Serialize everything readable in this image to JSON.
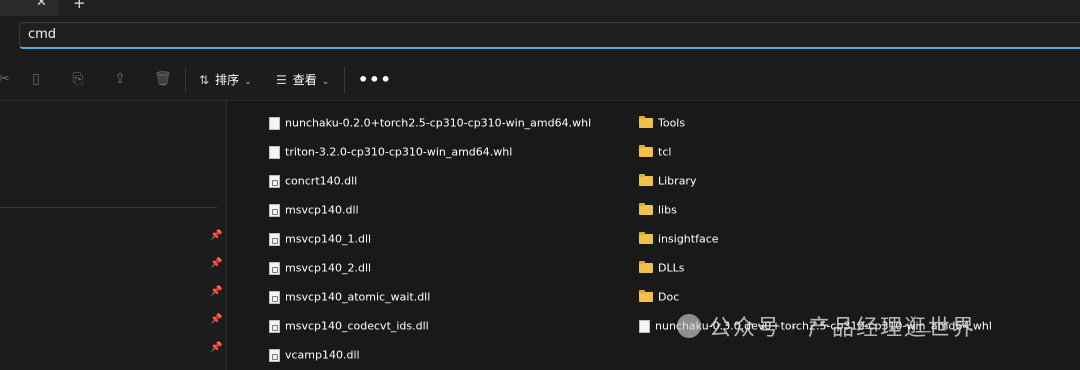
{
  "address_bar": {
    "value": "cmd"
  },
  "toolbar": {
    "sort_label": "排序",
    "view_label": "查看",
    "more_label": "•••"
  },
  "files_column1": [
    {
      "name": "nunchaku-0.2.0+torch2.5-cp310-cp310-win_amd64.whl",
      "type": "file"
    },
    {
      "name": "triton-3.2.0-cp310-cp310-win_amd64.whl",
      "type": "file"
    },
    {
      "name": "concrt140.dll",
      "type": "dll"
    },
    {
      "name": "msvcp140.dll",
      "type": "dll"
    },
    {
      "name": "msvcp140_1.dll",
      "type": "dll"
    },
    {
      "name": "msvcp140_2.dll",
      "type": "dll"
    },
    {
      "name": "msvcp140_atomic_wait.dll",
      "type": "dll"
    },
    {
      "name": "msvcp140_codecvt_ids.dll",
      "type": "dll"
    },
    {
      "name": "vcamp140.dll",
      "type": "dll"
    }
  ],
  "files_column2": [
    {
      "name": "Tools",
      "type": "folder"
    },
    {
      "name": "tcl",
      "type": "folder"
    },
    {
      "name": "Library",
      "type": "folder"
    },
    {
      "name": "libs",
      "type": "folder"
    },
    {
      "name": "insightface",
      "type": "folder"
    },
    {
      "name": "DLLs",
      "type": "folder"
    },
    {
      "name": "Doc",
      "type": "folder"
    },
    {
      "name": "nunchaku-0.3.0.dev0+torch2.5-cp310-cp310-win_amd64.whl",
      "type": "file"
    }
  ],
  "watermark": {
    "text": "公众号 · 产品经理逛世界"
  },
  "colors": {
    "accent": "#5aa8dc",
    "folder": "#f0c24c",
    "background": "#191919"
  }
}
